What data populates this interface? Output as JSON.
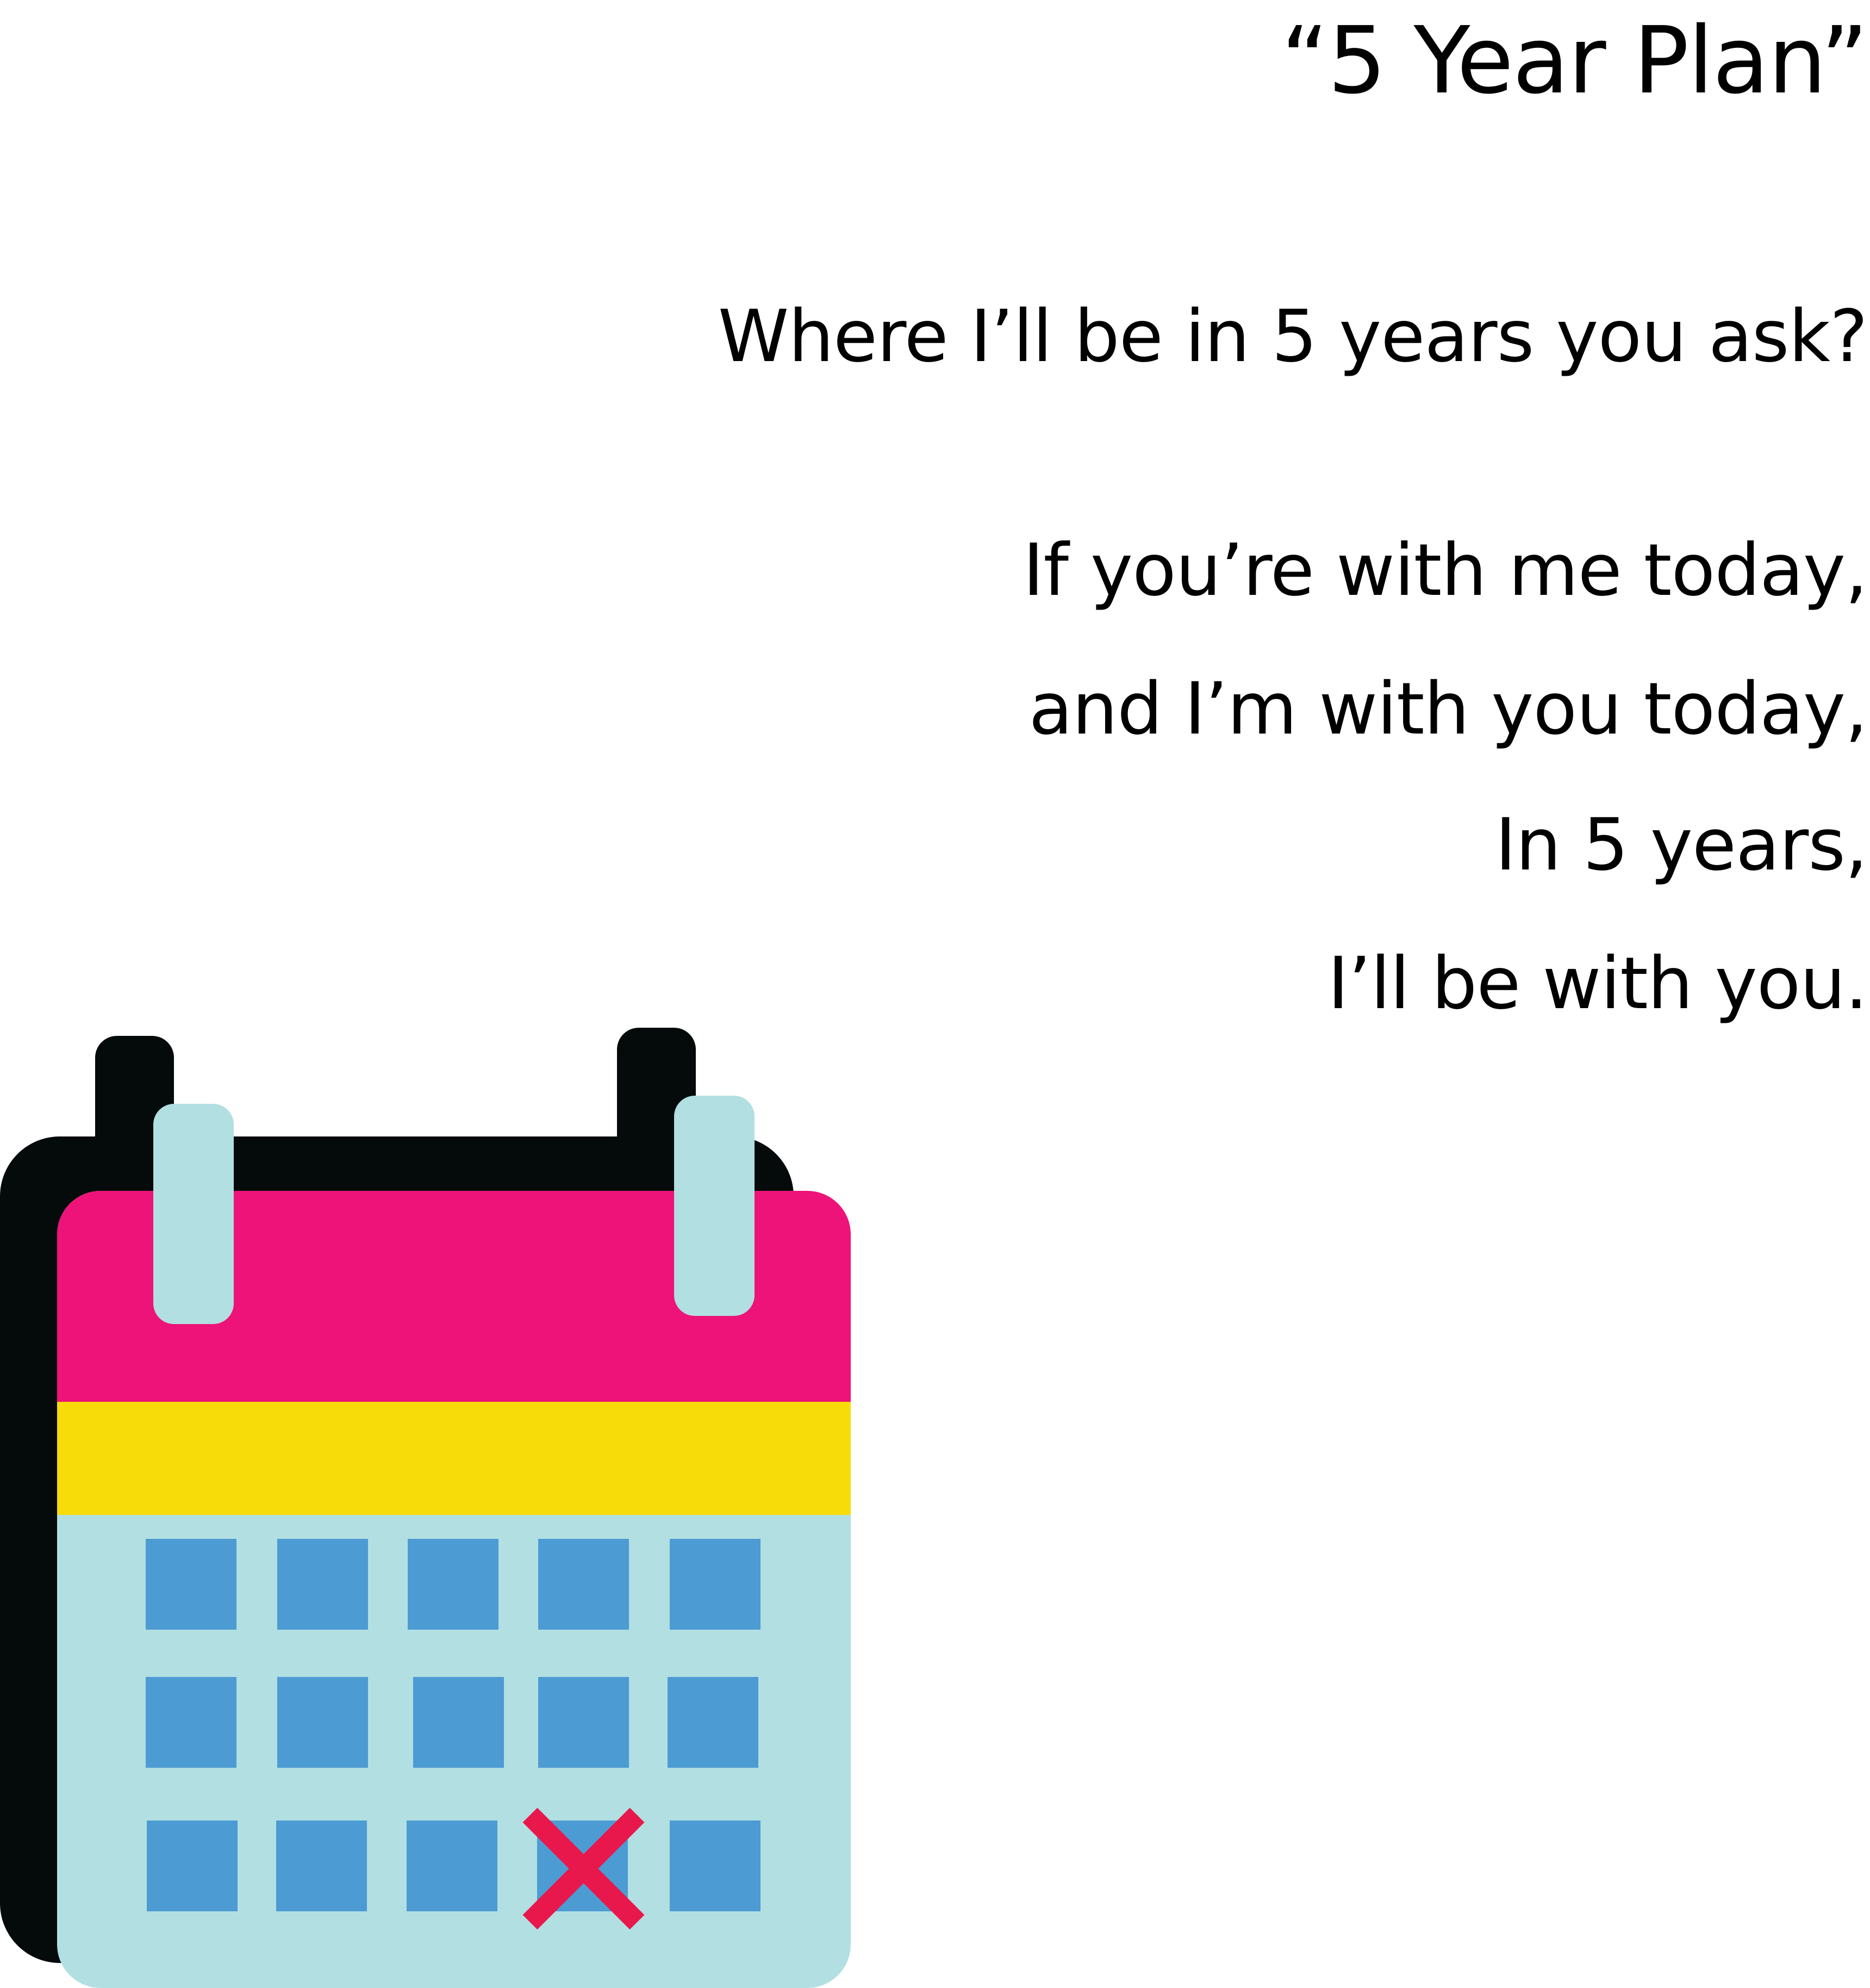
{
  "poem": {
    "title": "“5 Year Plan”",
    "question": "Where I’ll be in 5 years you ask?",
    "lines": [
      "If you’re with me today,",
      "and I’m with you today,",
      "In 5 years,",
      "I’ll be with you."
    ]
  },
  "illustration": {
    "icon": "calendar-icon",
    "grid": {
      "rows": 3,
      "columns": 5,
      "marked_cell": {
        "row": 3,
        "column": 4
      }
    },
    "colors": {
      "shadow": "#050a0b",
      "header": "#ed1378",
      "band": "#f7dc0a",
      "body": "#b2dfe1",
      "cell": "#4c9bd3",
      "rings": "#b2dfe1",
      "mark": "#e8174c"
    }
  }
}
